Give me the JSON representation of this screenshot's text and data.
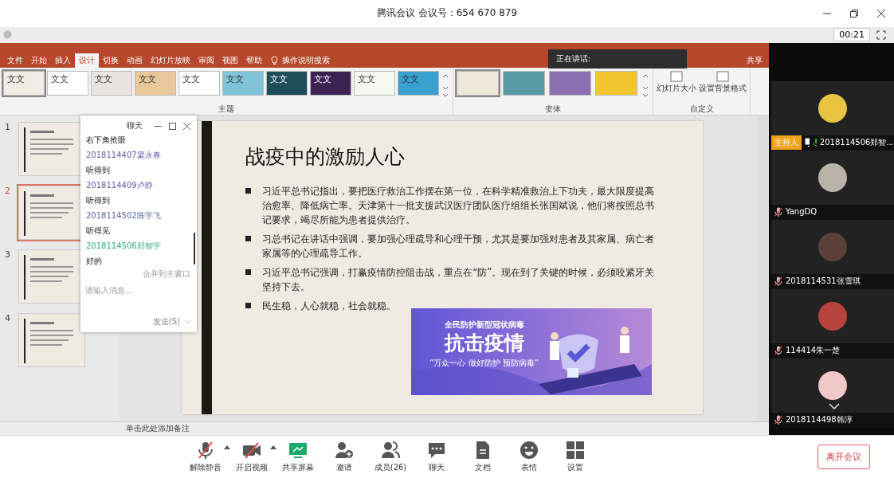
{
  "window": {
    "title": "腾讯会议 会议号：654 670 879",
    "timer": "00:21"
  },
  "ppt": {
    "menu": [
      {
        "label": "文件",
        "selected": false
      },
      {
        "label": "开始",
        "selected": false
      },
      {
        "label": "插入",
        "selected": false
      },
      {
        "label": "设计",
        "selected": true
      },
      {
        "label": "切换",
        "selected": false
      },
      {
        "label": "动画",
        "selected": false
      },
      {
        "label": "幻灯片放映",
        "selected": false
      },
      {
        "label": "审阅",
        "selected": false
      },
      {
        "label": "视图",
        "selected": false
      },
      {
        "label": "帮助",
        "selected": false
      }
    ],
    "search": "操作说明搜索",
    "share": "共享",
    "themes": [
      {
        "text": "文文",
        "color": "#f1ede4",
        "selected": true
      },
      {
        "text": "文文",
        "color": "#ffffff",
        "selected": false
      },
      {
        "text": "文文",
        "color": "#e9e4df",
        "selected": false
      },
      {
        "text": "文文",
        "color": "#e9c89a",
        "selected": false
      },
      {
        "text": "文文",
        "color": "#ffffff",
        "selected": false
      },
      {
        "text": "文文",
        "color": "#7fc3d6",
        "selected": false
      },
      {
        "text": "文文",
        "color": "#1f4e5a",
        "selected": false
      },
      {
        "text": "文文",
        "color": "#3a2350",
        "selected": false
      },
      {
        "text": "文文",
        "color": "#f4f8ee",
        "selected": false
      },
      {
        "text": "文文",
        "color": "#3aa0cf",
        "selected": false
      }
    ],
    "themes_label": "主题",
    "variants": [
      {
        "color": "#efe9dc",
        "selected": true
      },
      {
        "color": "#5a9aa6",
        "selected": false
      },
      {
        "color": "#8b6fb0",
        "selected": false
      },
      {
        "color": "#f2c530",
        "selected": false
      }
    ],
    "variants_label": "变体",
    "custom": [
      "幻灯片大小",
      "设置背景格式"
    ],
    "custom_label": "自定义",
    "thumbnails": [
      {
        "number": "1",
        "selected": false
      },
      {
        "number": "2",
        "selected": true
      },
      {
        "number": "3",
        "selected": false
      },
      {
        "number": "4",
        "selected": false
      }
    ],
    "slide": {
      "title": "战疫中的激励人心",
      "bullets": [
        "习近平总书记指出，要把医疗救治工作摆在第一位，在科学精准救治上下功夫，最大限度提高治愈率、降低病亡率。天津第十一批支援武汉医疗团队医疗组组长张国斌说，他们将按照总书记要求，竭尽所能为患者提供治疗。",
        "习总书记在讲话中强调，要加强心理疏导和心理干预，尤其是要加强对患者及其家属、病亡者家属等的心理疏导工作。",
        "习近平总书记强调，打赢疫情防控阻击战，重点在“防”。现在到了关键的时候，必须咬紧牙关坚持下去。",
        "民生稳，人心就稳，社会就稳。"
      ],
      "banner": {
        "subtitle": "全民防护新型冠状病毒",
        "title": "抗击疫情",
        "slogan": "“万众一心  做好防护  预防病毒”"
      }
    },
    "notes": "单击此处添加备注",
    "speaking": "正在讲话:"
  },
  "chat": {
    "title": "聊天",
    "messages": [
      {
        "text": "右下角抢眼"
      },
      {
        "sender": "2018114407梁永春",
        "self": false,
        "text": "听得到"
      },
      {
        "sender": "2018114409卢静",
        "self": false,
        "text": "听得到"
      },
      {
        "sender": "2018114502陈宇飞",
        "self": false,
        "text": "听得见"
      },
      {
        "sender": "2018114506郑智宇",
        "self": true,
        "text": "好的"
      }
    ],
    "merge": "合并到主窗口",
    "placeholder": "请输入消息...",
    "send": "发送(S)"
  },
  "participants": [
    {
      "name": "2018114506郑智...",
      "host": true,
      "host_label": "主持人",
      "sharing": true,
      "muted": false,
      "color": "#e8c440"
    },
    {
      "name": "YangDQ",
      "host": false,
      "sharing": false,
      "muted": true,
      "color": "#b9b3aa"
    },
    {
      "name": "2018114531张雪琪",
      "host": false,
      "sharing": false,
      "muted": true,
      "color": "#5a4038"
    },
    {
      "name": "114414朱一楚",
      "host": false,
      "sharing": false,
      "muted": true,
      "color": "#b8433c"
    },
    {
      "name": "2018114498韩淳",
      "host": false,
      "sharing": false,
      "muted": true,
      "color": "#f0c8c8"
    }
  ],
  "toolbar": [
    {
      "label": "解除静音",
      "kind": "mic",
      "caret": true
    },
    {
      "label": "开启视频",
      "kind": "video",
      "caret": true
    },
    {
      "label": "共享屏幕",
      "kind": "share",
      "caret": false
    },
    {
      "label": "邀请",
      "kind": "invite",
      "caret": false
    },
    {
      "label": "成员(26)",
      "kind": "members",
      "caret": false
    },
    {
      "label": "聊天",
      "kind": "chat",
      "caret": false
    },
    {
      "label": "文档",
      "kind": "doc",
      "caret": false
    },
    {
      "label": "表情",
      "kind": "emoji",
      "caret": false
    },
    {
      "label": "设置",
      "kind": "settings",
      "caret": false
    }
  ],
  "leave": "离开会议"
}
